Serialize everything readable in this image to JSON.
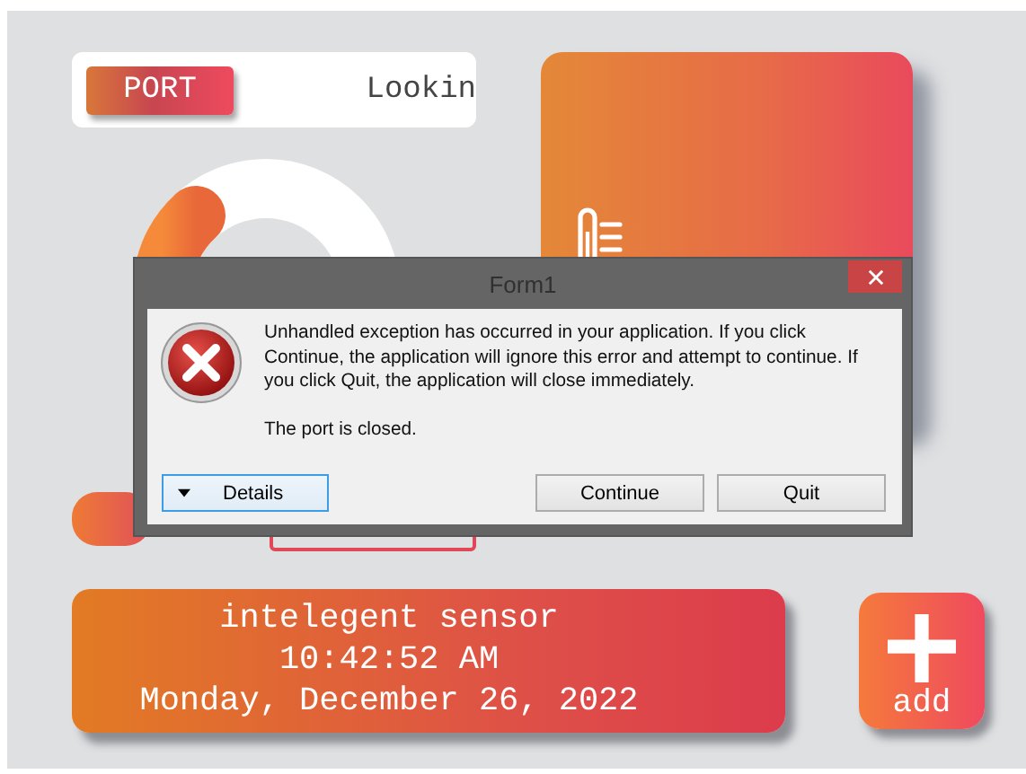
{
  "port": {
    "button": "PORT",
    "status": "Lookin"
  },
  "clock": {
    "title": "intelegent sensor",
    "time": "10:42:52 AM",
    "date": "Monday, December 26, 2022"
  },
  "add_button": {
    "label": "add"
  },
  "dialog": {
    "title": "Form1",
    "message": "Unhandled exception has occurred in your application. If you click Continue, the application will ignore this error and attempt to continue. If you click Quit, the application will close immediately.",
    "detail": "The port is closed.",
    "buttons": [
      {
        "label": "Details",
        "kind": "expander",
        "focused": true
      },
      {
        "label": "Continue",
        "kind": "push",
        "focused": false
      },
      {
        "label": "Quit",
        "kind": "push",
        "focused": false
      }
    ]
  }
}
